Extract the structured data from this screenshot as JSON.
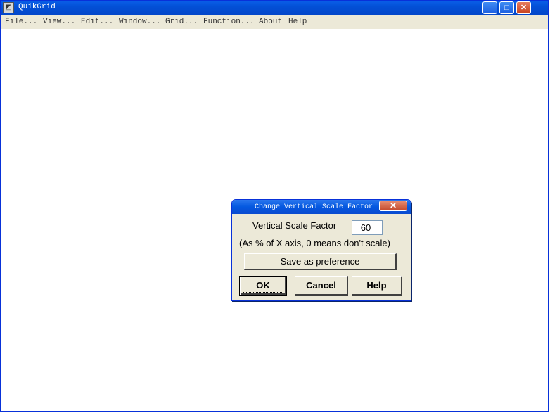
{
  "app": {
    "title": "QuikGrid",
    "icon": "quikgrid-app-icon"
  },
  "window_controls": {
    "minimize": "_",
    "maximize": "□",
    "close": "✕"
  },
  "menu": {
    "items": [
      "File...",
      "View...",
      "Edit...",
      "Window...",
      "Grid...",
      "Function...",
      "About",
      "Help"
    ]
  },
  "dialog": {
    "title": "Change Vertical Scale Factor",
    "close_glyph": "✕",
    "field_label": "Vertical Scale Factor",
    "field_value": "60",
    "hint": "(As % of X axis, 0 means don't scale)",
    "save_label": "Save as preference",
    "ok_label": "OK",
    "cancel_label": "Cancel",
    "help_label": "Help"
  }
}
